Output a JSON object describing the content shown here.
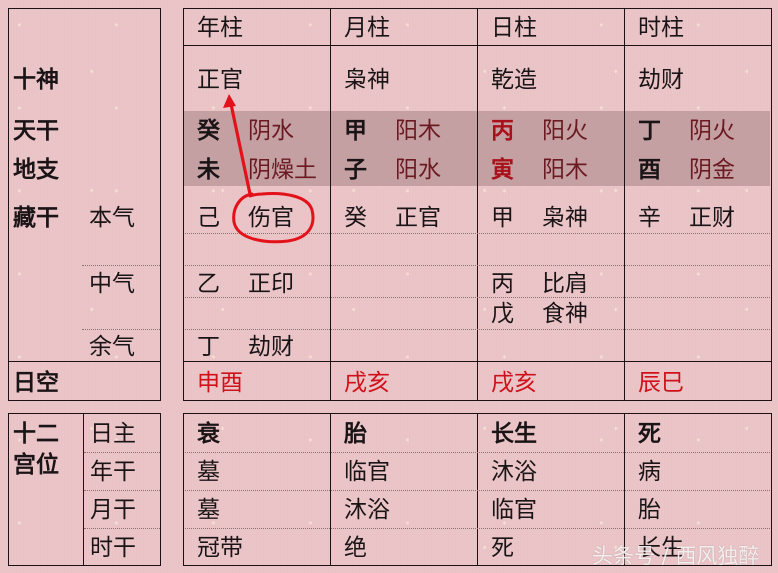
{
  "top_table": {
    "row_labels": {
      "shishen": "十神",
      "tiangan": "天干",
      "dizhi": "地支",
      "canggan": "藏干",
      "benqi": "本气",
      "zhongqi": "中气",
      "yuqi": "余气",
      "rikong": "日空"
    },
    "columns": [
      {
        "header": "年柱",
        "shishen": "正官",
        "gan": "癸",
        "gan_attr": "阴水",
        "zhi": "未",
        "zhi_attr": "阴燥土",
        "canggan": [
          [
            "己",
            "伤官"
          ],
          [
            "乙",
            "正印"
          ],
          [
            "丁",
            "劫财"
          ]
        ],
        "rikong": "申酉"
      },
      {
        "header": "月柱",
        "shishen": "枭神",
        "gan": "甲",
        "gan_attr": "阳木",
        "zhi": "子",
        "zhi_attr": "阳水",
        "canggan": [
          [
            "癸",
            "正官"
          ]
        ],
        "rikong": "戌亥"
      },
      {
        "header": "日柱",
        "shishen": "乾造",
        "gan": "丙",
        "gan_attr": "阳火",
        "zhi": "寅",
        "zhi_attr": "阳木",
        "canggan": [
          [
            "甲",
            "枭神"
          ],
          [
            "丙",
            "比肩"
          ],
          [
            "戊",
            "食神"
          ]
        ],
        "rikong": "戌亥"
      },
      {
        "header": "时柱",
        "shishen": "劫财",
        "gan": "丁",
        "gan_attr": "阴火",
        "zhi": "酉",
        "zhi_attr": "阴金",
        "canggan": [
          [
            "辛",
            "正财"
          ]
        ],
        "rikong": "辰巳"
      }
    ]
  },
  "bottom_table": {
    "title_line1": "十二",
    "title_line2": "宫位",
    "row_labels": [
      "日主",
      "年干",
      "月干",
      "时干"
    ],
    "columns": [
      [
        "衰",
        "墓",
        "墓",
        "冠带"
      ],
      [
        "胎",
        "临官",
        "沐浴",
        "绝"
      ],
      [
        "长生",
        "沐浴",
        "临官",
        "死"
      ],
      [
        "死",
        "病",
        "胎",
        "长生"
      ]
    ]
  },
  "annotation": {
    "color": "#e3121a",
    "note": "arrow from circled 伤官 to 正官"
  },
  "watermark": "头条号 / 西风独醉"
}
